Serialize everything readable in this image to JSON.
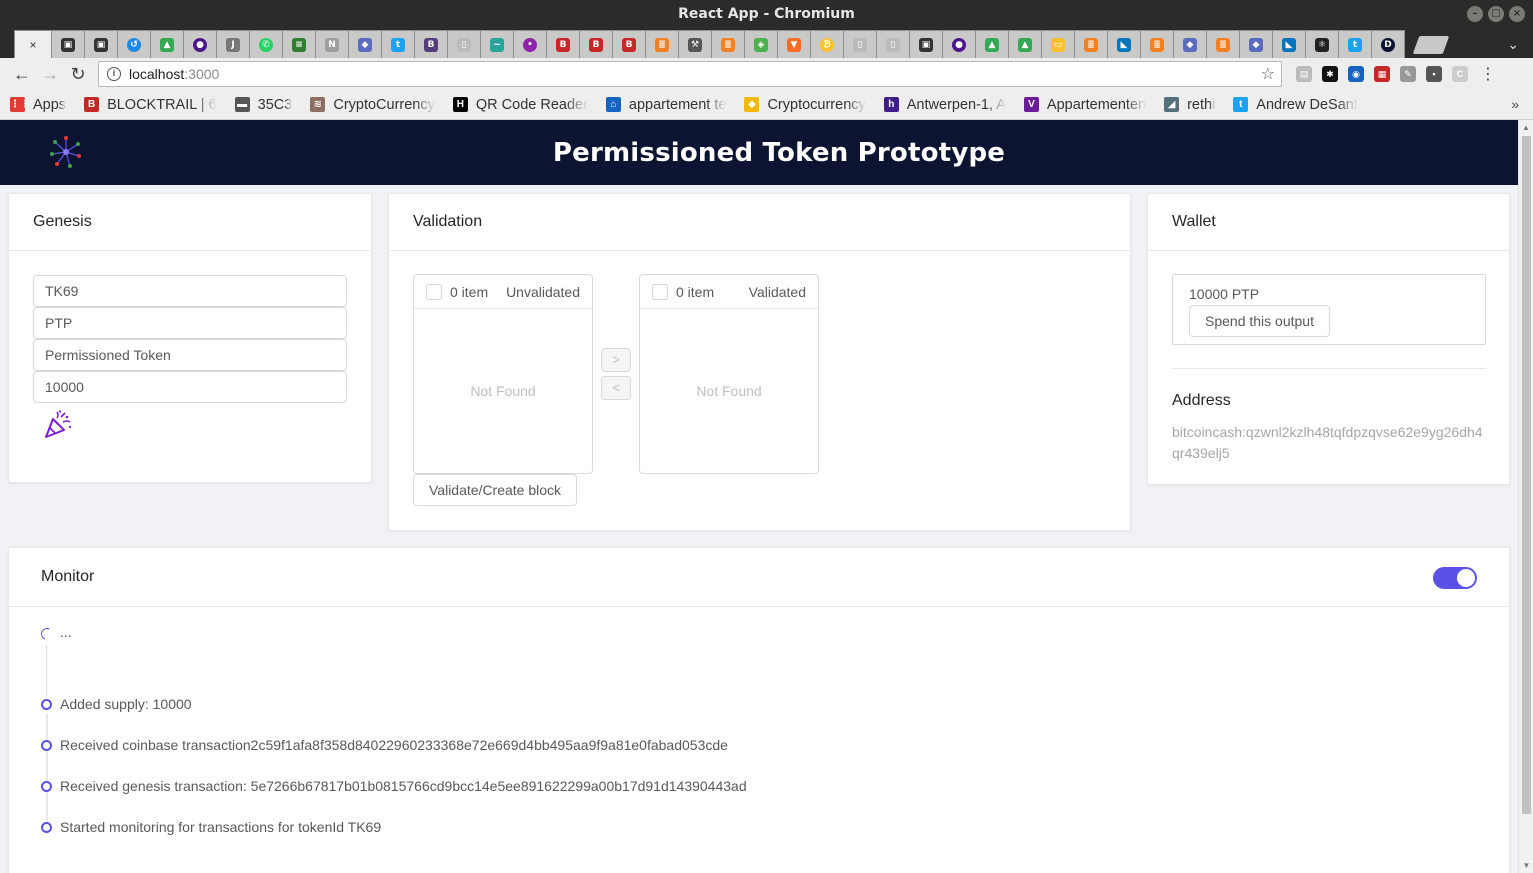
{
  "window": {
    "title": "React App - Chromium"
  },
  "browser": {
    "url_host": "localhost",
    "url_port": ":3000",
    "bookmarks": [
      {
        "label": "Apps",
        "icon": "apps-grid-icon",
        "color": "#e53935"
      },
      {
        "label": "BLOCKTRAIL | 6",
        "icon": "blocktrail-icon",
        "color": "#c62828"
      },
      {
        "label": "35C3",
        "icon": "folder-icon",
        "color": "#555555"
      },
      {
        "label": "CryptoCurrency",
        "icon": "crypto-icon",
        "color": "#8d6e63"
      },
      {
        "label": "QR Code Reader",
        "icon": "h-icon",
        "color": "#000000"
      },
      {
        "label": "appartement te",
        "icon": "home-icon",
        "color": "#1565c0"
      },
      {
        "label": "Cryptocurrency",
        "icon": "binance-icon",
        "color": "#f0b90b"
      },
      {
        "label": "Antwerpen-1, A",
        "icon": "h-purple-icon",
        "color": "#3f1e8c"
      },
      {
        "label": "Appartementen",
        "icon": "v-icon",
        "color": "#6a1b9a"
      },
      {
        "label": "rethi",
        "icon": "docker-icon",
        "color": "#546e7a"
      },
      {
        "label": "Andrew DeSant",
        "icon": "twitter-icon",
        "color": "#1da1f2"
      }
    ]
  },
  "app": {
    "title": "Permissioned Token Prototype"
  },
  "genesis": {
    "title": "Genesis",
    "fields": [
      "TK69",
      "PTP",
      "Permissioned Token",
      "10000"
    ]
  },
  "validation": {
    "title": "Validation",
    "left": {
      "count": "0 item",
      "title": "Unvalidated",
      "empty": "Not Found"
    },
    "right": {
      "count": "0 item",
      "title": "Validated",
      "empty": "Not Found"
    },
    "move_right": ">",
    "move_left": "<",
    "button_label": "Validate/Create block"
  },
  "wallet": {
    "title": "Wallet",
    "utxo_amount": "10000 PTP",
    "spend_label": "Spend this output",
    "address_label": "Address",
    "address_value": "bitcoincash:qzwnl2kzlh48tqfdpzqvse62e9yg26dh4qr439elj5"
  },
  "monitor": {
    "title": "Monitor",
    "toggle_on": true,
    "accent": "#5b51e6",
    "pending": "...",
    "events": [
      "Added supply: 10000",
      "Received coinbase transaction2c59f1afa8f358d84022960233368e72e669d4bb495aa9f9a81e0fabad053cde",
      "Received genesis transaction: 5e7266b67817b01b0815766cd9bcc14e5ee891622299a00b17d91d14390443ad",
      "Started monitoring for transactions for tokenId TK69"
    ]
  }
}
